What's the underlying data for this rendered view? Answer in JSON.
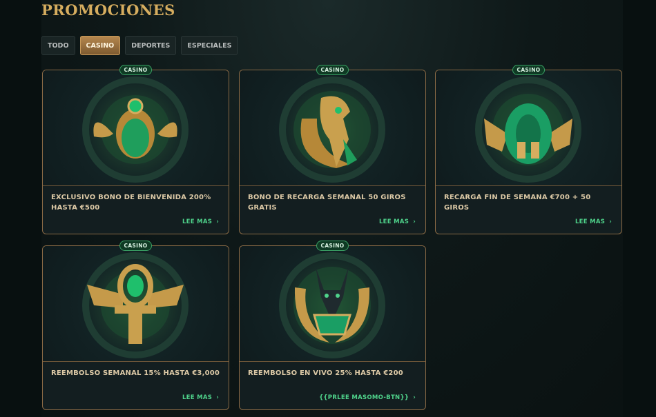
{
  "page": {
    "title": "PROMOCIONES"
  },
  "tabs": [
    {
      "label": "TODO",
      "active": false
    },
    {
      "label": "CASINO",
      "active": true
    },
    {
      "label": "DEPORTES",
      "active": false
    },
    {
      "label": "ESPECIALES",
      "active": false
    }
  ],
  "cards": [
    {
      "badge": "CASINO",
      "title": "EXCLUSIVO BONO DE BIENVENIDA 200% HASTA €500",
      "link": "LEE MAS",
      "icon": "scarab-icon"
    },
    {
      "badge": "CASINO",
      "title": "BONO DE RECARGA SEMANAL 50 GIROS GRATIS",
      "link": "LEE MAS",
      "icon": "horus-falcon-icon"
    },
    {
      "badge": "CASINO",
      "title": "RECARGA FIN DE SEMANA €700 + 50 GIROS",
      "link": "LEE MAS",
      "icon": "serpent-icon"
    },
    {
      "badge": "CASINO",
      "title": "REEMBOLSO SEMANAL 15% HASTA €3,000",
      "link": "LEE MAS",
      "icon": "ankh-icon"
    },
    {
      "badge": "CASINO",
      "title": "REEMBOLSO EN VIVO 25% HASTA €200",
      "link": "{{PRLEE MASOMO-BTN}}",
      "icon": "anubis-icon"
    }
  ],
  "colors": {
    "gold": "#d6ad5f",
    "green": "#4fd38b",
    "border": "#8a6a45"
  }
}
